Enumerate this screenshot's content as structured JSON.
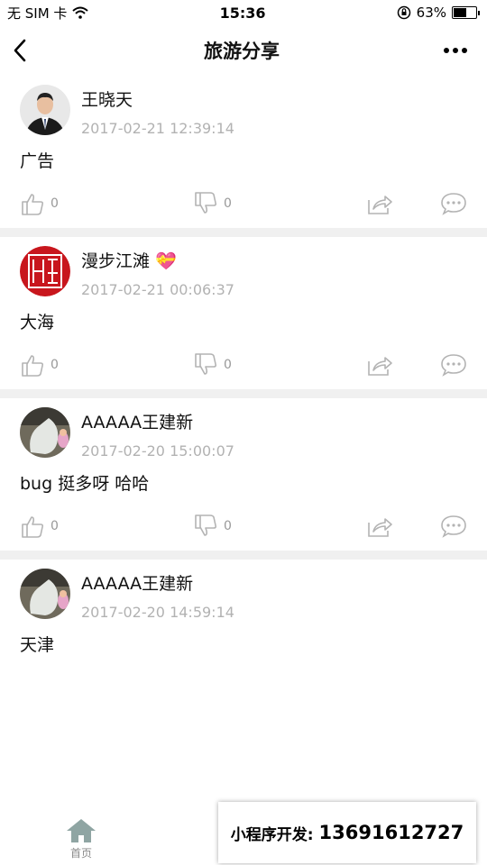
{
  "status": {
    "carrier": "无 SIM 卡",
    "time": "15:36",
    "battery": "63%",
    "battery_level": 0.63
  },
  "nav": {
    "title": "旅游分享",
    "back_icon": "back-chevron-icon",
    "more_icon": "more-dots-icon"
  },
  "posts": [
    {
      "name": "王晓天",
      "time": "2017-02-21 12:39:14",
      "content": "广告",
      "likes": "0",
      "dislikes": "0"
    },
    {
      "name": "漫步江滩 💝",
      "time": "2017-02-21 00:06:37",
      "content": "大海",
      "likes": "0",
      "dislikes": "0"
    },
    {
      "name": "AAAAA王建新",
      "time": "2017-02-20 15:00:07",
      "content": "bug 挺多呀 哈哈",
      "likes": "0",
      "dislikes": "0"
    },
    {
      "name": "AAAAA王建新",
      "time": "2017-02-20 14:59:14",
      "content": "天津"
    }
  ],
  "tabbar": {
    "home_label": "首页"
  },
  "promo": {
    "label": "小程序开发:",
    "phone": "13691612727"
  }
}
